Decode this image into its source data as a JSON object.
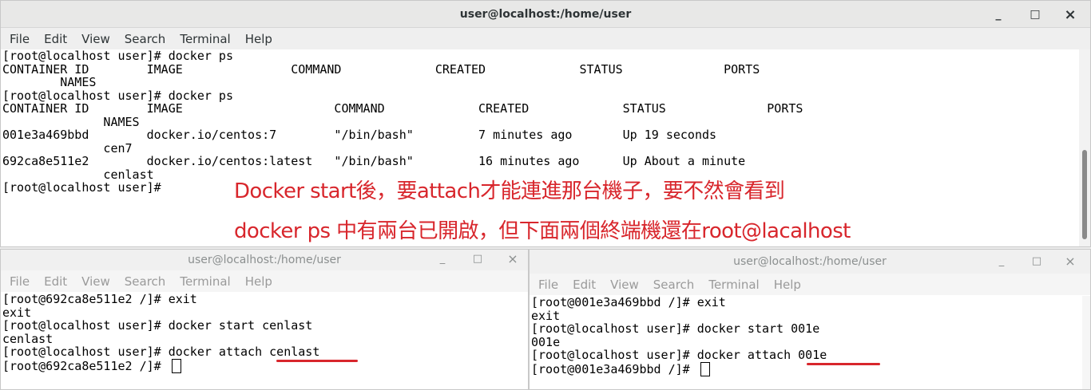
{
  "main": {
    "title": "user@localhost:/home/user",
    "controls": {
      "minimize": "_",
      "maximize": "□",
      "close": "×"
    },
    "menu": [
      "File",
      "Edit",
      "View",
      "Search",
      "Terminal",
      "Help"
    ],
    "lines": [
      "[root@localhost user]# docker ps",
      "CONTAINER ID        IMAGE               COMMAND             CREATED             STATUS              PORTS",
      "        NAMES",
      "[root@localhost user]# docker ps",
      "CONTAINER ID        IMAGE                     COMMAND             CREATED             STATUS              PORTS",
      "              NAMES",
      "001e3a469bbd        docker.io/centos:7        \"/bin/bash\"         7 minutes ago       Up 19 seconds",
      "              cen7",
      "692ca8e511e2        docker.io/centos:latest   \"/bin/bash\"         16 minutes ago      Up About a minute",
      "              cenlast",
      "[root@localhost user]#"
    ],
    "annotation": {
      "line1": "Docker start後，要attach才能連進那台機子，要不然會看到",
      "line2": "docker ps 中有兩台已開啟，但下面兩個終端機還在root@lacalhost"
    }
  },
  "left": {
    "title": "user@localhost:/home/user",
    "controls": {
      "minimize": "_",
      "maximize": "□",
      "close": "×"
    },
    "menu": [
      "File",
      "Edit",
      "View",
      "Search",
      "Terminal",
      "Help"
    ],
    "lines": [
      "[root@692ca8e511e2 /]# exit",
      "exit",
      "[root@localhost user]# docker start cenlast",
      "cenlast",
      "[root@localhost user]# docker attach cenlast",
      "[root@692ca8e511e2 /]# "
    ]
  },
  "right": {
    "title": "user@localhost:/home/user",
    "controls": {
      "minimize": "_",
      "maximize": "□",
      "close": "×"
    },
    "menu": [
      "File",
      "Edit",
      "View",
      "Search",
      "Terminal",
      "Help"
    ],
    "lines": [
      "[root@001e3a469bbd /]# exit",
      "exit",
      "[root@localhost user]# docker start 001e",
      "001e",
      "[root@localhost user]# docker attach 001e",
      "[root@001e3a469bbd /]# "
    ]
  }
}
